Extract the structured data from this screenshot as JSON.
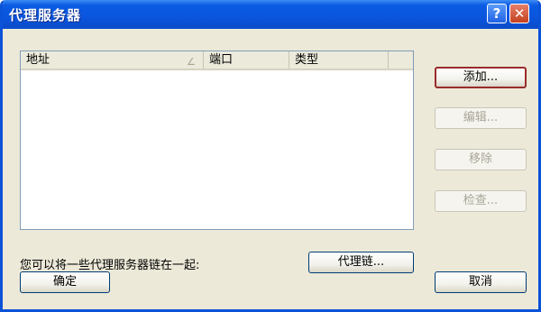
{
  "window": {
    "title": "代理服务器"
  },
  "titlebar": {
    "help_label": "?",
    "close_label": "✕"
  },
  "list": {
    "columns": [
      "地址",
      "端口",
      "类型"
    ],
    "sort_indicator": "∠"
  },
  "buttons": {
    "add": "添加...",
    "edit": "编辑...",
    "remove": "移除",
    "check": "检查...",
    "chain": "代理链...",
    "ok": "确定",
    "cancel": "取消"
  },
  "chain_text": "您可以将一些代理服务器链在一起:",
  "colors": {
    "titlebar": "#0a55dd",
    "dialog_bg": "#ece9d8",
    "default_border": "#9a2b2b"
  }
}
